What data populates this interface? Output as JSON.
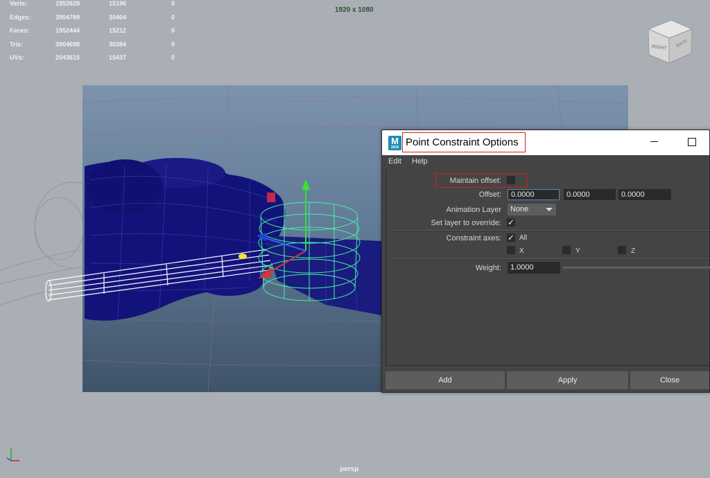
{
  "hud": {
    "rows": [
      {
        "label": "Verts:",
        "v1": "1952628",
        "v2": "15196",
        "v3": "0"
      },
      {
        "label": "Edges:",
        "v1": "3904799",
        "v2": "30404",
        "v3": "0"
      },
      {
        "label": "Faces:",
        "v1": "1952444",
        "v2": "15212",
        "v3": "0"
      },
      {
        "label": "Tris:",
        "v1": "3904698",
        "v2": "30384",
        "v3": "0"
      },
      {
        "label": "UVs:",
        "v1": "2043615",
        "v2": "15437",
        "v3": "0"
      }
    ]
  },
  "viewport": {
    "resolution": "1920 x 1080",
    "camera": "persp",
    "viewcube": {
      "right": "RIGHT",
      "back": "BACK"
    }
  },
  "dialog": {
    "app_icon": "M",
    "app_icon_sub": "2019",
    "title": "Point Constraint Options",
    "menus": [
      "Edit",
      "Help"
    ],
    "maintain_offset_label": "Maintain offset:",
    "maintain_offset_checked": false,
    "offset_label": "Offset:",
    "offset_values": [
      "0.0000",
      "0.0000",
      "0.0000"
    ],
    "animation_layer_label": "Animation Layer",
    "animation_layer_value": "None",
    "set_layer_label": "Set layer to override:",
    "set_layer_checked": true,
    "constraint_axes_label": "Constraint axes:",
    "axes": {
      "all": "All",
      "x": "X",
      "y": "Y",
      "z": "Z"
    },
    "all_checked": true,
    "weight_label": "Weight:",
    "weight_value": "1.0000",
    "buttons": {
      "add": "Add",
      "apply": "Apply",
      "close": "Close"
    },
    "check_mark": "✓"
  },
  "colors": {
    "background": "#a9afb5",
    "dialog_bg": "#444444",
    "highlight": "#d41c1c",
    "mesh_wire": "#0f0f6e",
    "selection_wire": "#44f0a8"
  },
  "icons": [
    "minimize-icon",
    "maximize-icon",
    "viewcube-icon",
    "axis-gizmo-icon",
    "dropdown-caret-icon",
    "move-manipulator-icon"
  ]
}
